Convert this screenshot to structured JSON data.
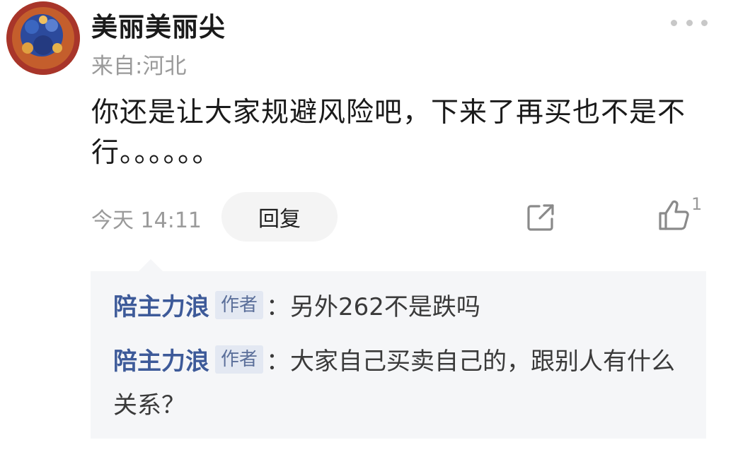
{
  "comment": {
    "username": "美丽美丽尖",
    "location": "来自:河北",
    "content": "你还是让大家规避风险吧，下来了再买也不是不行。。。。。。",
    "time": "今天 14:11",
    "reply_label": "回复",
    "like_count": "1",
    "icons": {
      "more": "more-dots-icon",
      "share": "share-icon",
      "like": "thumbs-up-icon"
    }
  },
  "replies": [
    {
      "name": "陪主力浪",
      "badge": "作者",
      "text": "：另外262不是跌吗"
    },
    {
      "name": "陪主力浪",
      "badge": "作者",
      "text": "：大家自己买卖自己的，跟别人有什么关系？"
    }
  ],
  "colors": {
    "author_name": "#3d5a99",
    "badge_bg": "#e3e8f2",
    "reply_bg": "#f5f6f8",
    "muted_text": "#9a9a9a"
  }
}
